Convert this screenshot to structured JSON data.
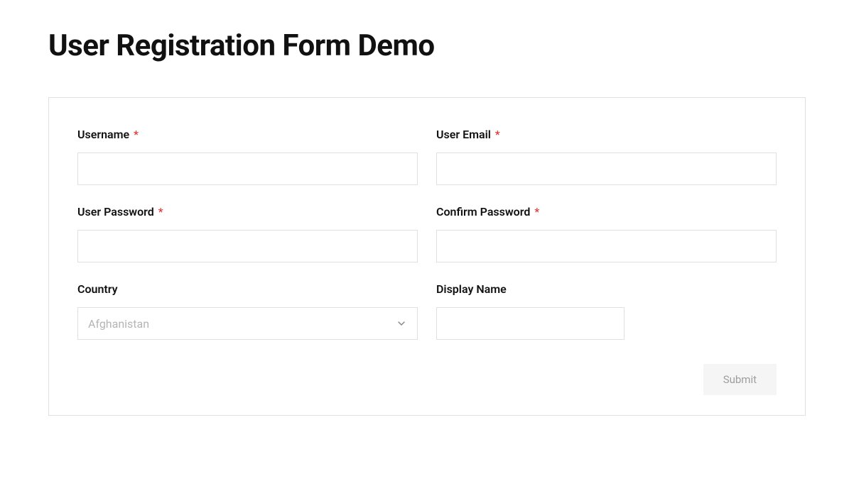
{
  "page": {
    "title": "User Registration Form Demo"
  },
  "form": {
    "required_marker": "*",
    "fields": {
      "username": {
        "label": "Username",
        "required": true,
        "value": ""
      },
      "user_email": {
        "label": "User Email",
        "required": true,
        "value": ""
      },
      "user_password": {
        "label": "User Password",
        "required": true,
        "value": ""
      },
      "confirm_password": {
        "label": "Confirm Password",
        "required": true,
        "value": ""
      },
      "country": {
        "label": "Country",
        "required": false,
        "selected": "Afghanistan"
      },
      "display_name": {
        "label": "Display Name",
        "required": false,
        "value": ""
      }
    },
    "submit_label": "Submit"
  }
}
